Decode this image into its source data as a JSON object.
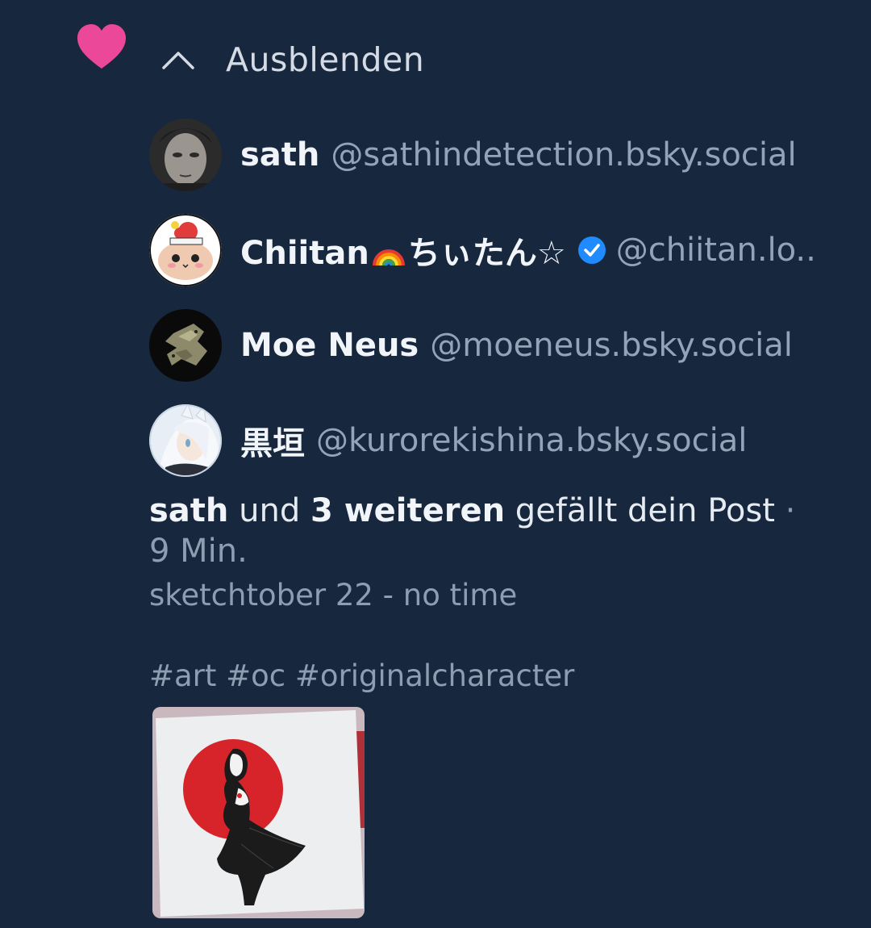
{
  "notification": {
    "type_icon": "heart-icon",
    "heart_color": "#ec4899",
    "collapse_icon": "chevron-up-icon",
    "collapse_label": "Ausblenden"
  },
  "likers": [
    {
      "display_name": "sath",
      "handle": "@sathindetection.bsky.social",
      "avatar": "avatar-icon"
    },
    {
      "display_name_prefix": "Chiitan",
      "display_name_suffix": "ちぃたん☆",
      "emoji": "rainbow-icon",
      "verified_icon": "verified-badge-icon",
      "handle": "@chiitan.lo..",
      "avatar": "avatar-icon"
    },
    {
      "display_name": "Moe Neus",
      "handle": "@moeneus.bsky.social",
      "avatar": "avatar-icon"
    },
    {
      "display_name": "黒垣",
      "handle": "@kurorekishina.bsky.social",
      "avatar": "avatar-icon"
    }
  ],
  "summary": {
    "first_name": "sath",
    "connector": "und",
    "others": "3 weiteren",
    "action": "gefällt dein Post",
    "separator": "·",
    "time": "9 Min."
  },
  "post": {
    "title": "sketchtober 22 - no time",
    "tags": "#art #oc #originalcharacter",
    "image": "post-thumbnail"
  },
  "colors": {
    "background": "#17273d",
    "text_primary": "#f1f4f8",
    "text_secondary": "#93a3b8",
    "verified": "#208bfe"
  }
}
